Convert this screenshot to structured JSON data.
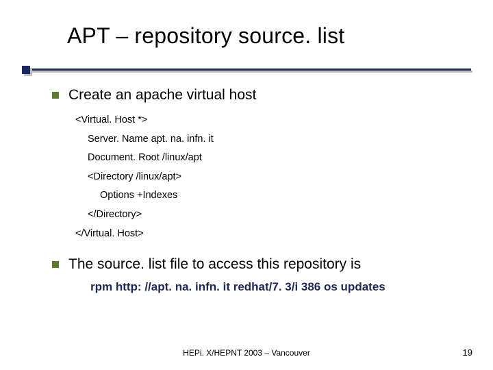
{
  "title": "APT – repository source. list",
  "bullets": {
    "b1": "Create an apache virtual host",
    "b2": "The source. list file to access this repository is"
  },
  "code": {
    "l1": "<Virtual. Host *>",
    "l2": "Server. Name apt. na. infn. it",
    "l3": "Document. Root /linux/apt",
    "l4": "<Directory /linux/apt>",
    "l5": "Options +Indexes",
    "l6": "</Directory>",
    "l7": "</Virtual. Host>"
  },
  "rpm_line": "rpm http: //apt. na. infn. it redhat/7. 3/i 386 os updates",
  "footer": "HEPi. X/HEPNT 2003 – Vancouver",
  "page_number": "19"
}
